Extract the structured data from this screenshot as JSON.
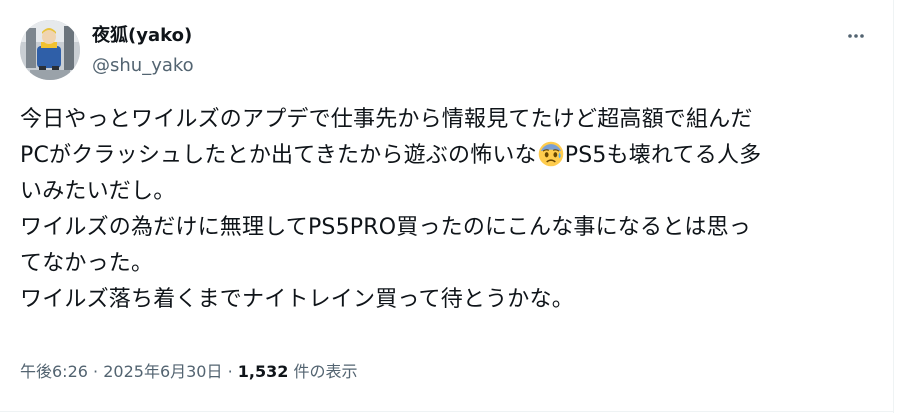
{
  "tweet": {
    "author": {
      "display_name": "夜狐(yako)",
      "handle": "@shu_yako",
      "avatar_icon": "avatar-figure-icon"
    },
    "more_icon": "more-horizontal-icon",
    "text_lines": {
      "l1": "今日やっとワイルズのアプデで仕事先から情報見てたけど超高額で組んだ",
      "l2a": "PCがクラッシュしたとか出てきたから遊ぶの怖いな",
      "l2_emoji": "anxious-face-with-sweat-icon",
      "l2b": "PS5も壊れてる人多",
      "l3": "いみたいだし。",
      "l4": "ワイルズの為だけに無理してPS5PRO買ったのにこんな事になるとは思っ",
      "l5": "てなかった。",
      "l6": "ワイルズ落ち着くまでナイトレイン買って待とうかな。"
    },
    "meta": {
      "time": "午後6:26",
      "separator": "·",
      "date": "2025年6月30日",
      "views_count": "1,532",
      "views_label": " 件の表示"
    },
    "colors": {
      "text_primary": "#0f1419",
      "text_secondary": "#536471",
      "border": "#eff3f4",
      "emoji_face": "#ffcc4d",
      "emoji_forehead": "#7a9fd4"
    }
  }
}
